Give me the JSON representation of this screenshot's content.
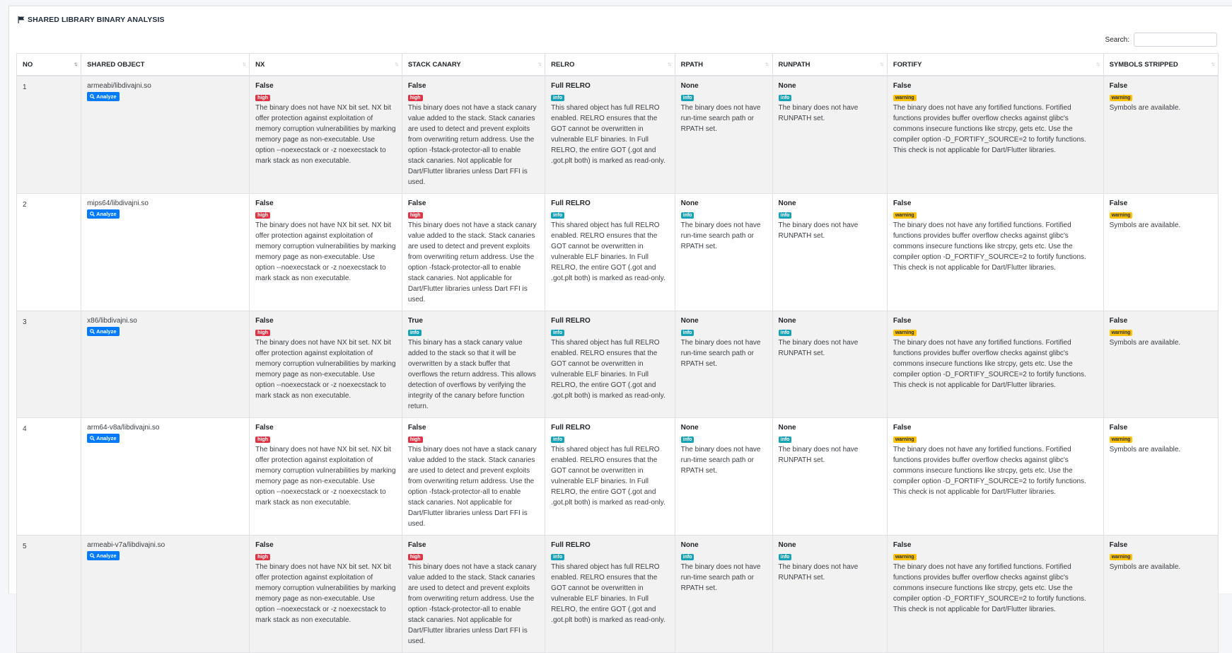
{
  "section_title": "SHARED LIBRARY BINARY ANALYSIS",
  "search": {
    "label": "Search:",
    "placeholder": ""
  },
  "columns": [
    "NO",
    "SHARED OBJECT",
    "NX",
    "STACK CANARY",
    "RELRO",
    "RPATH",
    "RUNPATH",
    "FORTIFY",
    "SYMBOLS STRIPPED"
  ],
  "analyze_label": "Analyze",
  "badge_colors": {
    "high": "#dc3545",
    "info": "#17a2b8",
    "warning": "#ffc107"
  },
  "rows": [
    {
      "no": "1",
      "shared_object": "armeabi/libdivajni.so",
      "nx": {
        "value": "False",
        "badge": "high",
        "desc": "The binary does not have NX bit set. NX bit offer protection against exploitation of memory corruption vulnerabilities by marking memory page as non-executable. Use option --noexecstack or -z noexecstack to mark stack as non executable."
      },
      "stack_canary": {
        "value": "False",
        "badge": "high",
        "desc": "This binary does not have a stack canary value added to the stack. Stack canaries are used to detect and prevent exploits from overwriting return address. Use the option -fstack-protector-all to enable stack canaries. Not applicable for Dart/Flutter libraries unless Dart FFI is used."
      },
      "relro": {
        "value": "Full RELRO",
        "badge": "info",
        "desc": "This shared object has full RELRO enabled. RELRO ensures that the GOT cannot be overwritten in vulnerable ELF binaries. In Full RELRO, the entire GOT (.got and .got.plt both) is marked as read-only."
      },
      "rpath": {
        "value": "None",
        "badge": "info",
        "desc": "The binary does not have run-time search path or RPATH set."
      },
      "runpath": {
        "value": "None",
        "badge": "info",
        "desc": "The binary does not have RUNPATH set."
      },
      "fortify": {
        "value": "False",
        "badge": "warning",
        "desc": "The binary does not have any fortified functions. Fortified functions provides buffer overflow checks against glibc's commons insecure functions like strcpy, gets etc. Use the compiler option -D_FORTIFY_SOURCE=2 to fortify functions. This check is not applicable for Dart/Flutter libraries."
      },
      "symbols": {
        "value": "False",
        "badge": "warning",
        "desc": "Symbols are available."
      }
    },
    {
      "no": "2",
      "shared_object": "mips64/libdivajni.so",
      "nx": {
        "value": "False",
        "badge": "high",
        "desc": "The binary does not have NX bit set. NX bit offer protection against exploitation of memory corruption vulnerabilities by marking memory page as non-executable. Use option --noexecstack or -z noexecstack to mark stack as non executable."
      },
      "stack_canary": {
        "value": "False",
        "badge": "high",
        "desc": "This binary does not have a stack canary value added to the stack. Stack canaries are used to detect and prevent exploits from overwriting return address. Use the option -fstack-protector-all to enable stack canaries. Not applicable for Dart/Flutter libraries unless Dart FFI is used."
      },
      "relro": {
        "value": "Full RELRO",
        "badge": "info",
        "desc": "This shared object has full RELRO enabled. RELRO ensures that the GOT cannot be overwritten in vulnerable ELF binaries. In Full RELRO, the entire GOT (.got and .got.plt both) is marked as read-only."
      },
      "rpath": {
        "value": "None",
        "badge": "info",
        "desc": "The binary does not have run-time search path or RPATH set."
      },
      "runpath": {
        "value": "None",
        "badge": "info",
        "desc": "The binary does not have RUNPATH set."
      },
      "fortify": {
        "value": "False",
        "badge": "warning",
        "desc": "The binary does not have any fortified functions. Fortified functions provides buffer overflow checks against glibc's commons insecure functions like strcpy, gets etc. Use the compiler option -D_FORTIFY_SOURCE=2 to fortify functions. This check is not applicable for Dart/Flutter libraries."
      },
      "symbols": {
        "value": "False",
        "badge": "warning",
        "desc": "Symbols are available."
      }
    },
    {
      "no": "3",
      "shared_object": "x86/libdivajni.so",
      "nx": {
        "value": "False",
        "badge": "high",
        "desc": "The binary does not have NX bit set. NX bit offer protection against exploitation of memory corruption vulnerabilities by marking memory page as non-executable. Use option --noexecstack or -z noexecstack to mark stack as non executable."
      },
      "stack_canary": {
        "value": "True",
        "badge": "info",
        "desc": "This binary has a stack canary value added to the stack so that it will be overwritten by a stack buffer that overflows the return address. This allows detection of overflows by verifying the integrity of the canary before function return."
      },
      "relro": {
        "value": "Full RELRO",
        "badge": "info",
        "desc": "This shared object has full RELRO enabled. RELRO ensures that the GOT cannot be overwritten in vulnerable ELF binaries. In Full RELRO, the entire GOT (.got and .got.plt both) is marked as read-only."
      },
      "rpath": {
        "value": "None",
        "badge": "info",
        "desc": "The binary does not have run-time search path or RPATH set."
      },
      "runpath": {
        "value": "None",
        "badge": "info",
        "desc": "The binary does not have RUNPATH set."
      },
      "fortify": {
        "value": "False",
        "badge": "warning",
        "desc": "The binary does not have any fortified functions. Fortified functions provides buffer overflow checks against glibc's commons insecure functions like strcpy, gets etc. Use the compiler option -D_FORTIFY_SOURCE=2 to fortify functions. This check is not applicable for Dart/Flutter libraries."
      },
      "symbols": {
        "value": "False",
        "badge": "warning",
        "desc": "Symbols are available."
      }
    },
    {
      "no": "4",
      "shared_object": "arm64-v8a/libdivajni.so",
      "nx": {
        "value": "False",
        "badge": "high",
        "desc": "The binary does not have NX bit set. NX bit offer protection against exploitation of memory corruption vulnerabilities by marking memory page as non-executable. Use option --noexecstack or -z noexecstack to mark stack as non executable."
      },
      "stack_canary": {
        "value": "False",
        "badge": "high",
        "desc": "This binary does not have a stack canary value added to the stack. Stack canaries are used to detect and prevent exploits from overwriting return address. Use the option -fstack-protector-all to enable stack canaries. Not applicable for Dart/Flutter libraries unless Dart FFI is used."
      },
      "relro": {
        "value": "Full RELRO",
        "badge": "info",
        "desc": "This shared object has full RELRO enabled. RELRO ensures that the GOT cannot be overwritten in vulnerable ELF binaries. In Full RELRO, the entire GOT (.got and .got.plt both) is marked as read-only."
      },
      "rpath": {
        "value": "None",
        "badge": "info",
        "desc": "The binary does not have run-time search path or RPATH set."
      },
      "runpath": {
        "value": "None",
        "badge": "info",
        "desc": "The binary does not have RUNPATH set."
      },
      "fortify": {
        "value": "False",
        "badge": "warning",
        "desc": "The binary does not have any fortified functions. Fortified functions provides buffer overflow checks against glibc's commons insecure functions like strcpy, gets etc. Use the compiler option -D_FORTIFY_SOURCE=2 to fortify functions. This check is not applicable for Dart/Flutter libraries."
      },
      "symbols": {
        "value": "False",
        "badge": "warning",
        "desc": "Symbols are available."
      }
    },
    {
      "no": "5",
      "shared_object": "armeabi-v7a/libdivajni.so",
      "nx": {
        "value": "False",
        "badge": "high",
        "desc": "The binary does not have NX bit set. NX bit offer protection against exploitation of memory corruption vulnerabilities by marking memory page as non-executable. Use option --noexecstack or -z noexecstack to mark stack as non executable."
      },
      "stack_canary": {
        "value": "False",
        "badge": "high",
        "desc": "This binary does not have a stack canary value added to the stack. Stack canaries are used to detect and prevent exploits from overwriting return address. Use the option -fstack-protector-all to enable stack canaries. Not applicable for Dart/Flutter libraries unless Dart FFI is used."
      },
      "relro": {
        "value": "Full RELRO",
        "badge": "info",
        "desc": "This shared object has full RELRO enabled. RELRO ensures that the GOT cannot be overwritten in vulnerable ELF binaries. In Full RELRO, the entire GOT (.got and .got.plt both) is marked as read-only."
      },
      "rpath": {
        "value": "None",
        "badge": "info",
        "desc": "The binary does not have run-time search path or RPATH set."
      },
      "runpath": {
        "value": "None",
        "badge": "info",
        "desc": "The binary does not have RUNPATH set."
      },
      "fortify": {
        "value": "False",
        "badge": "warning",
        "desc": "The binary does not have any fortified functions. Fortified functions provides buffer overflow checks against glibc's commons insecure functions like strcpy, gets etc. Use the compiler option -D_FORTIFY_SOURCE=2 to fortify functions. This check is not applicable for Dart/Flutter libraries."
      },
      "symbols": {
        "value": "False",
        "badge": "warning",
        "desc": "Symbols are available."
      }
    }
  ]
}
